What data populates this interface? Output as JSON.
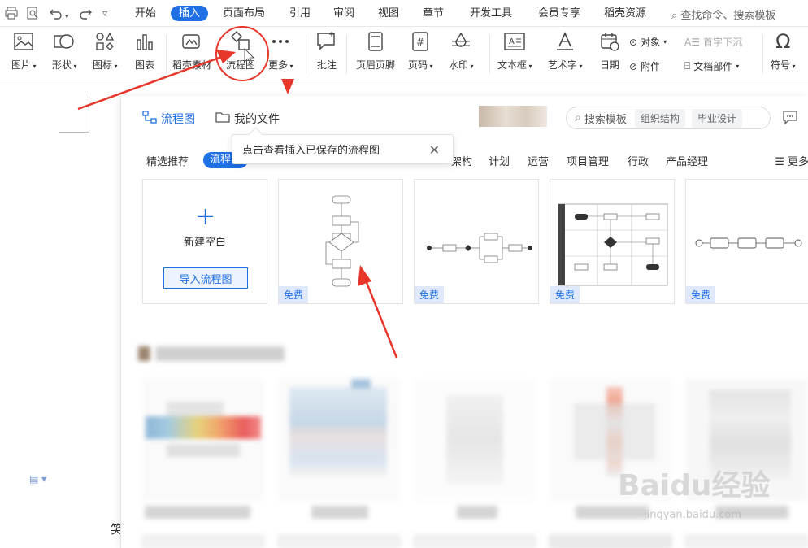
{
  "menubar": {
    "tabs": [
      "开始",
      "插入",
      "页面布局",
      "引用",
      "审阅",
      "视图",
      "章节",
      "开发工具",
      "会员专享",
      "稻壳资源"
    ],
    "active_tab": "插入",
    "search_command": "查找命令、搜索模板"
  },
  "toolbar": {
    "tools": [
      {
        "label": "图片",
        "icon": "picture-icon",
        "dropdown": true
      },
      {
        "label": "形状",
        "icon": "shape-icon",
        "dropdown": true
      },
      {
        "label": "图标",
        "icon": "icons-icon",
        "dropdown": true
      },
      {
        "label": "图表",
        "icon": "chart-icon",
        "dropdown": false
      },
      {
        "label": "稻壳素材",
        "icon": "material-icon",
        "dropdown": false
      },
      {
        "label": "流程图",
        "icon": "flowchart-icon",
        "dropdown": false
      },
      {
        "label": "更多",
        "icon": "more-icon",
        "dropdown": true
      },
      {
        "label": "批注",
        "icon": "comment-icon",
        "dropdown": false
      },
      {
        "label": "页眉页脚",
        "icon": "header-footer-icon",
        "dropdown": false
      },
      {
        "label": "页码",
        "icon": "page-number-icon",
        "dropdown": true
      },
      {
        "label": "水印",
        "icon": "watermark-icon",
        "dropdown": true
      },
      {
        "label": "文本框",
        "icon": "textbox-icon",
        "dropdown": true
      },
      {
        "label": "艺术字",
        "icon": "wordart-icon",
        "dropdown": true
      },
      {
        "label": "日期",
        "icon": "date-icon",
        "dropdown": false
      },
      {
        "label": "符号",
        "icon": "symbol-icon",
        "dropdown": true
      }
    ],
    "object_label": "对象",
    "attachment_label": "附件",
    "dropcap_label": "首字下沉",
    "docpart_label": "文档部件"
  },
  "dialog": {
    "tab_flowchart": "流程图",
    "tab_myfiles": "我的文件",
    "search_placeholder": "搜索模板",
    "chips": [
      "组织结构",
      "毕业设计"
    ],
    "categories": [
      "精选推荐",
      "流程图",
      "架构",
      "计划",
      "运营",
      "项目管理",
      "行政",
      "产品经理"
    ],
    "active_category": "流程图",
    "more_label": "更多",
    "tooltip": "点击查看插入已保存的流程图",
    "new_blank": "新建空白",
    "import_button": "导入流程图",
    "free_badge": "免费"
  },
  "colors": {
    "accent": "#1f6fe5",
    "arrow": "#e8362a",
    "badge_bg": "#dfe9fb"
  },
  "watermark": {
    "brand": "Baidu经验",
    "url": "jingyan.baidu.com"
  }
}
